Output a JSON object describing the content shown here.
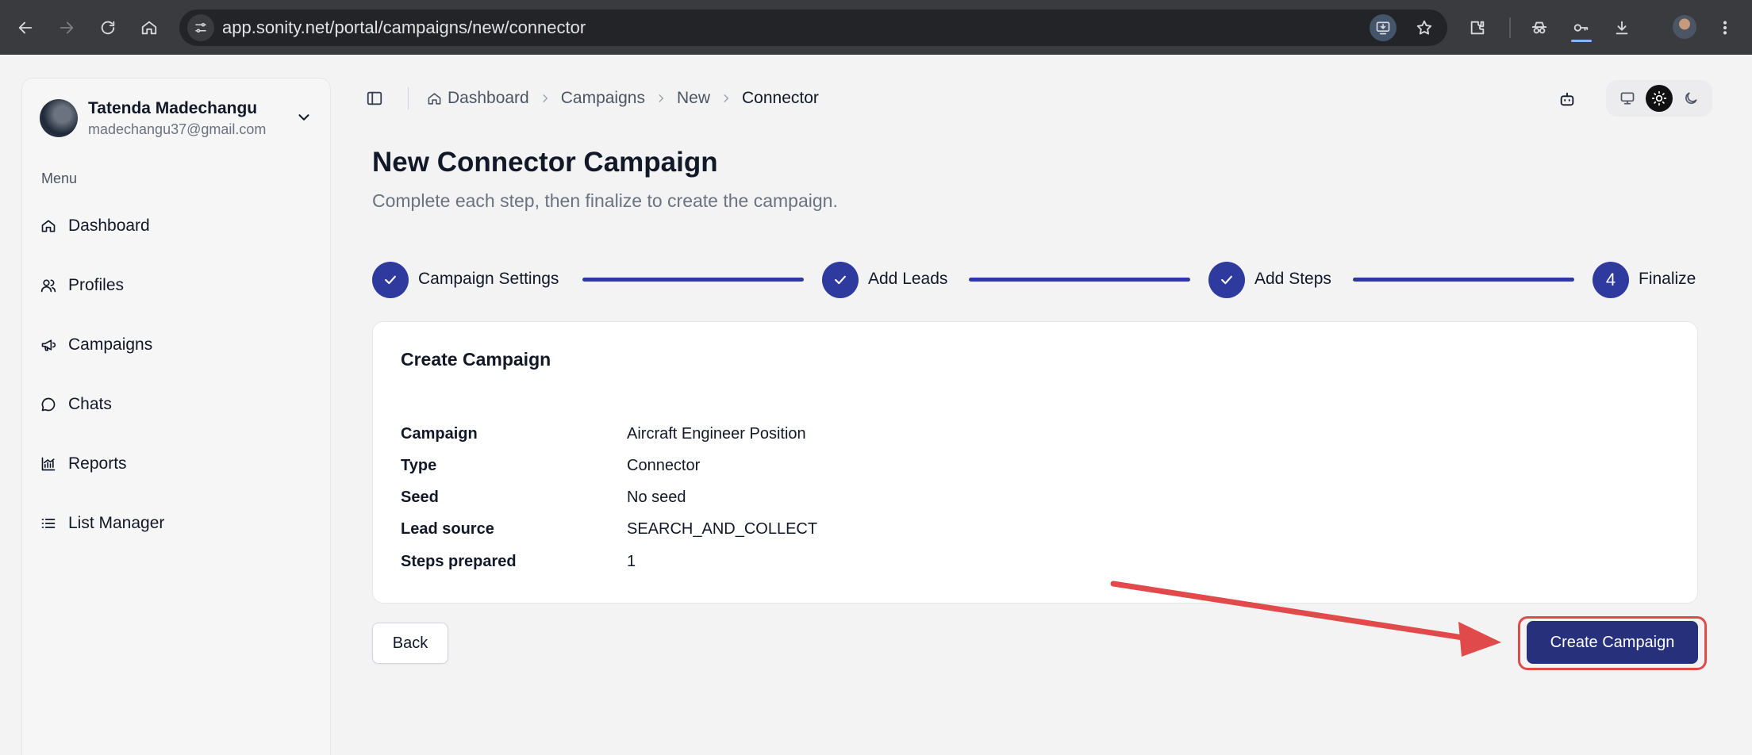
{
  "browser": {
    "url": "app.sonity.net/portal/campaigns/new/connector"
  },
  "sidebar": {
    "user": {
      "name": "Tatenda Madechangu",
      "email": "madechangu37@gmail.com"
    },
    "menu_label": "Menu",
    "items": [
      {
        "label": "Dashboard",
        "icon": "home-icon"
      },
      {
        "label": "Profiles",
        "icon": "users-icon"
      },
      {
        "label": "Campaigns",
        "icon": "megaphone-icon"
      },
      {
        "label": "Chats",
        "icon": "chat-bubble-icon"
      },
      {
        "label": "Reports",
        "icon": "chart-icon"
      },
      {
        "label": "List Manager",
        "icon": "list-icon"
      }
    ]
  },
  "breadcrumb": [
    "Dashboard",
    "Campaigns",
    "New",
    "Connector"
  ],
  "page": {
    "title": "New Connector Campaign",
    "subtitle": "Complete each step, then finalize to create the campaign."
  },
  "stepper": {
    "steps": [
      {
        "label": "Campaign Settings",
        "state": "done"
      },
      {
        "label": "Add Leads",
        "state": "done"
      },
      {
        "label": "Add Steps",
        "state": "done"
      },
      {
        "label": "Finalize",
        "state": "current",
        "number": "4"
      }
    ]
  },
  "card": {
    "title": "Create Campaign",
    "rows": [
      {
        "key": "Campaign",
        "value": "Aircraft Engineer Position"
      },
      {
        "key": "Type",
        "value": "Connector"
      },
      {
        "key": "Seed",
        "value": "No seed"
      },
      {
        "key": "Lead source",
        "value": "SEARCH_AND_COLLECT"
      },
      {
        "key": "Steps prepared",
        "value": "1"
      }
    ]
  },
  "actions": {
    "back_label": "Back",
    "create_label": "Create Campaign"
  },
  "colors": {
    "accent": "#2e3a9e",
    "primary_button": "#27307a",
    "highlight": "#e04a4a"
  }
}
